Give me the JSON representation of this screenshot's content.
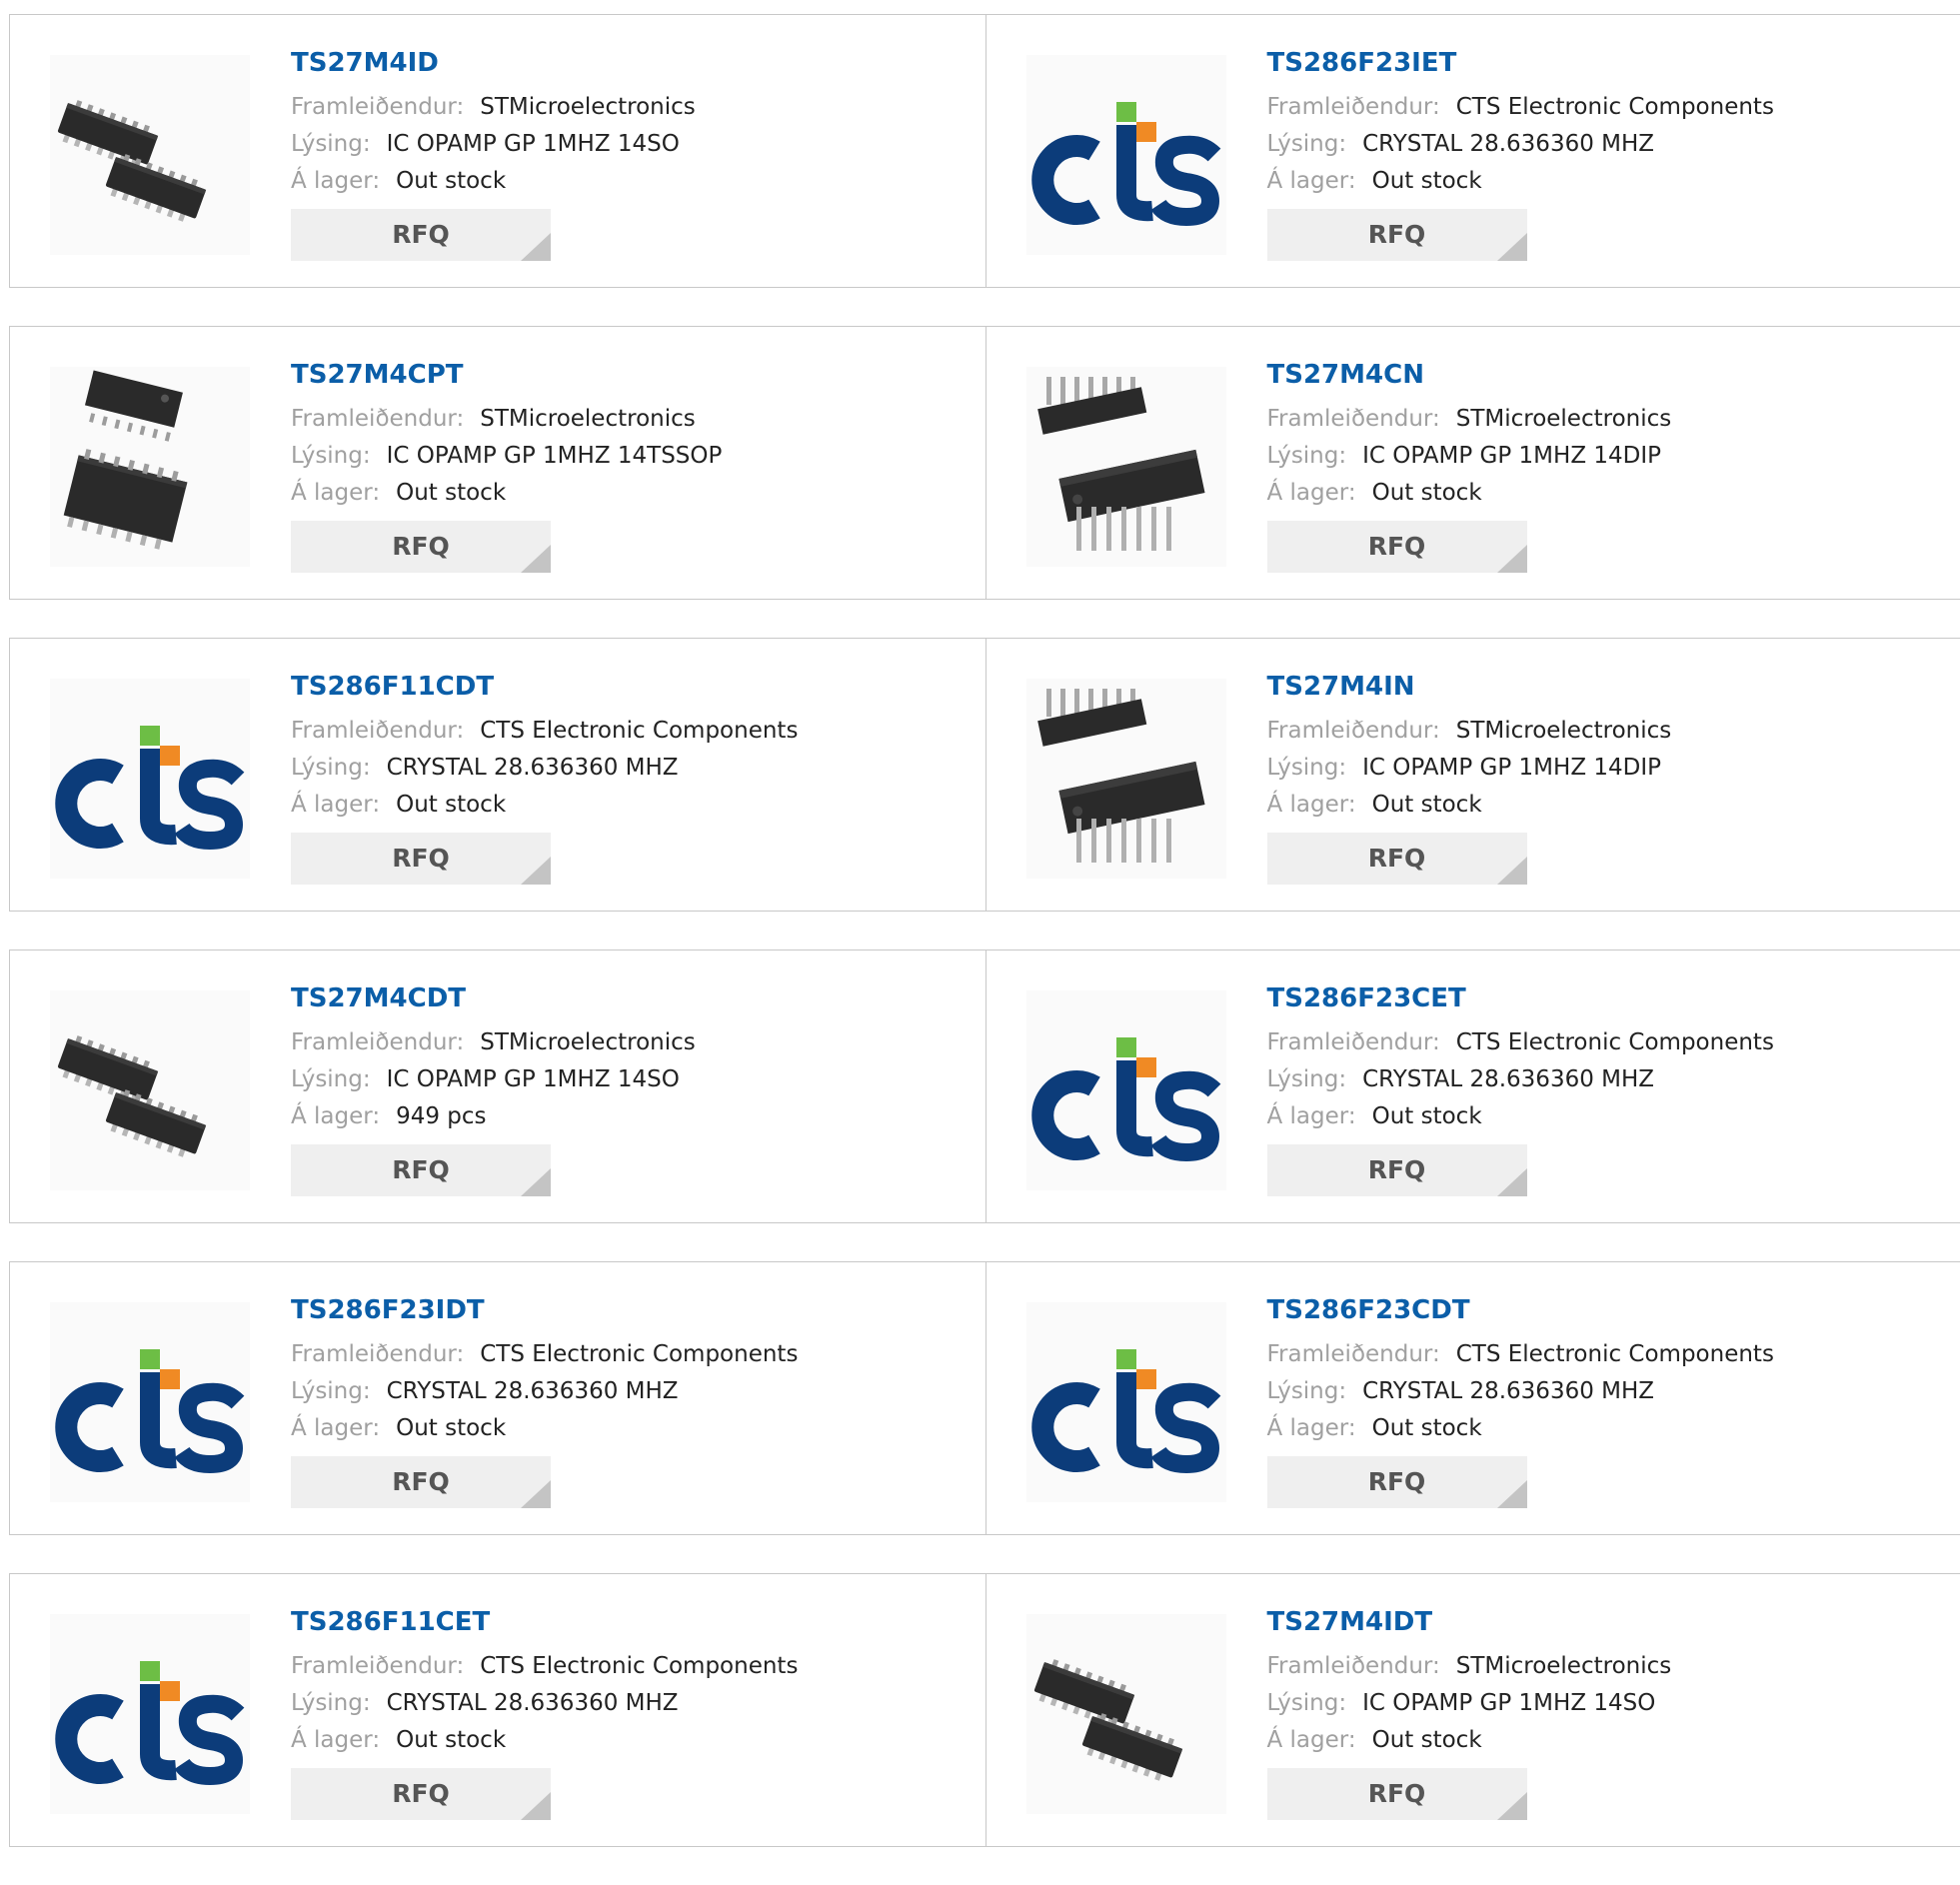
{
  "labels": {
    "manufacturer": "Framleiðendur:",
    "description": "Lýsing:",
    "stock": "Á lager:",
    "rfq": "RFQ"
  },
  "colors": {
    "part_link": "#0b5ea8",
    "cts_blue": "#0c3c7a",
    "cts_green": "#6dbe45",
    "cts_orange": "#f08a24",
    "chip_body": "#2a2a2a",
    "rfq_bg": "#efefef"
  },
  "products": [
    {
      "part": "TS27M4ID",
      "manufacturer": "STMicroelectronics",
      "description": "IC OPAMP GP 1MHZ 14SO",
      "stock": "Out stock",
      "image": "so14-chip-icon"
    },
    {
      "part": "TS286F23IET",
      "manufacturer": "CTS Electronic Components",
      "description": "CRYSTAL 28.636360 MHZ",
      "stock": "Out stock",
      "image": "cts-logo-icon"
    },
    {
      "part": "TS27M4CPT",
      "manufacturer": "STMicroelectronics",
      "description": "IC OPAMP GP 1MHZ 14TSSOP",
      "stock": "Out stock",
      "image": "tssop14-chip-icon"
    },
    {
      "part": "TS27M4CN",
      "manufacturer": "STMicroelectronics",
      "description": "IC OPAMP GP 1MHZ 14DIP",
      "stock": "Out stock",
      "image": "dip14-chip-icon"
    },
    {
      "part": "TS286F11CDT",
      "manufacturer": "CTS Electronic Components",
      "description": "CRYSTAL 28.636360 MHZ",
      "stock": "Out stock",
      "image": "cts-logo-icon"
    },
    {
      "part": "TS27M4IN",
      "manufacturer": "STMicroelectronics",
      "description": "IC OPAMP GP 1MHZ 14DIP",
      "stock": "Out stock",
      "image": "dip14-chip-icon"
    },
    {
      "part": "TS27M4CDT",
      "manufacturer": "STMicroelectronics",
      "description": "IC OPAMP GP 1MHZ 14SO",
      "stock": "949 pcs",
      "image": "so14-chip-icon"
    },
    {
      "part": "TS286F23CET",
      "manufacturer": "CTS Electronic Components",
      "description": "CRYSTAL 28.636360 MHZ",
      "stock": "Out stock",
      "image": "cts-logo-icon"
    },
    {
      "part": "TS286F23IDT",
      "manufacturer": "CTS Electronic Components",
      "description": "CRYSTAL 28.636360 MHZ",
      "stock": "Out stock",
      "image": "cts-logo-icon"
    },
    {
      "part": "TS286F23CDT",
      "manufacturer": "CTS Electronic Components",
      "description": "CRYSTAL 28.636360 MHZ",
      "stock": "Out stock",
      "image": "cts-logo-icon"
    },
    {
      "part": "TS286F11CET",
      "manufacturer": "CTS Electronic Components",
      "description": "CRYSTAL 28.636360 MHZ",
      "stock": "Out stock",
      "image": "cts-logo-icon"
    },
    {
      "part": "TS27M4IDT",
      "manufacturer": "STMicroelectronics",
      "description": "IC OPAMP GP 1MHZ 14SO",
      "stock": "Out stock",
      "image": "so14-chip-icon"
    }
  ]
}
